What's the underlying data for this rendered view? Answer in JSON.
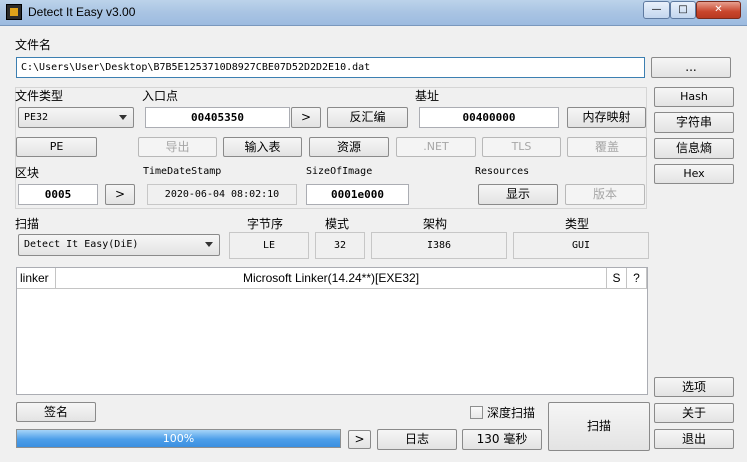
{
  "window": {
    "title": "Detect It Easy v3.00",
    "minimize": "—",
    "maximize": "□",
    "close": "✕"
  },
  "file": {
    "label": "文件名",
    "path": "C:\\Users\\User\\Desktop\\B7B5E1253710D8927CBE07D52D2D2E10.dat",
    "browse": "..."
  },
  "filetype": {
    "label": "文件类型",
    "value": "PE32",
    "pe_button": "PE"
  },
  "entry": {
    "label": "入口点",
    "value": "00405350",
    "go": ">",
    "disasm": "反汇编"
  },
  "base": {
    "label": "基址",
    "value": "00400000",
    "memmap": "内存映射"
  },
  "sections_buttons": {
    "export": "导出",
    "import": "输入表",
    "resources": "资源",
    "dotnet": ".NET",
    "tls": "TLS",
    "overlay": "覆盖"
  },
  "section": {
    "label": "区块",
    "value": "0005",
    "go": ">"
  },
  "timestamp": {
    "label": "TimeDateStamp",
    "value": "2020-06-04 08:02:10"
  },
  "sizeofimage": {
    "label": "SizeOfImage",
    "value": "0001e000"
  },
  "resources": {
    "label": "Resources",
    "show": "显示",
    "version": "版本"
  },
  "side": {
    "hash": "Hash",
    "strings": "字符串",
    "entropy": "信息熵",
    "hex": "Hex",
    "options": "选项",
    "about": "关于",
    "exit": "退出"
  },
  "scan": {
    "label": "扫描",
    "engine": "Detect It Easy(DiE)",
    "endian_label": "字节序",
    "endian": "LE",
    "mode_label": "模式",
    "mode": "32",
    "arch_label": "架构",
    "arch": "I386",
    "type_label": "类型",
    "type": "GUI"
  },
  "results": [
    {
      "type": "linker",
      "name": "Microsoft Linker(14.24**)[EXE32]",
      "s": "S",
      "info": "?"
    }
  ],
  "bottom": {
    "signatures": "签名",
    "progress_text": "100%",
    "progress": 1.0,
    "go": ">",
    "log": "日志",
    "time": "130 毫秒",
    "deep_scan": "深度扫描",
    "deep_scan_checked": false,
    "scan": "扫描"
  }
}
